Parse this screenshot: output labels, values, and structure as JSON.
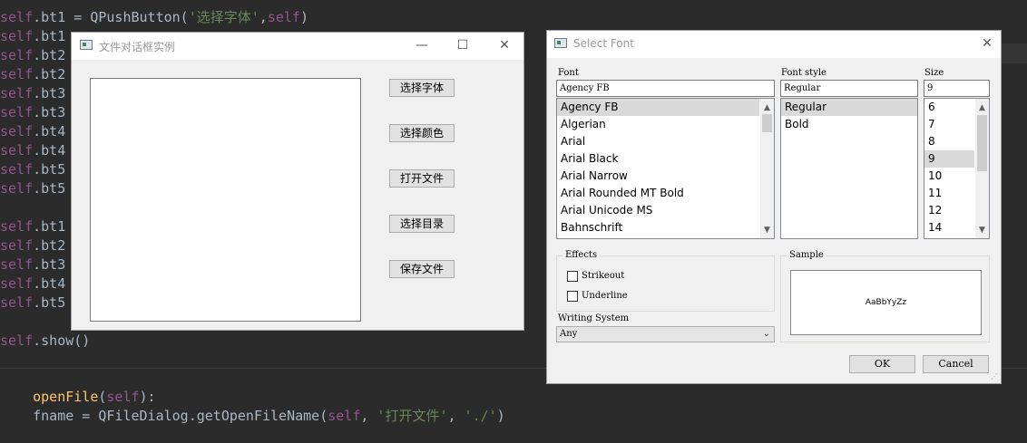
{
  "editor": {
    "lines": [
      {
        "pre": "",
        "self": "self",
        "mid": ".bt1 = QPushButton(",
        "str": "'选择字体'",
        "post": ",",
        "self2": "self",
        "end": ")"
      },
      {
        "pre": "",
        "self": "self",
        "mid": ".bt1",
        "str": "",
        "post": "",
        "self2": "",
        "end": ""
      },
      {
        "pre": "",
        "self": "self",
        "mid": ".bt2",
        "str": "",
        "post": "",
        "self2": "",
        "end": ""
      },
      {
        "pre": "",
        "self": "self",
        "mid": ".bt2",
        "str": "",
        "post": "",
        "self2": "",
        "end": ""
      },
      {
        "pre": "",
        "self": "self",
        "mid": ".bt3",
        "str": "",
        "post": "",
        "self2": "",
        "end": ""
      },
      {
        "pre": "",
        "self": "self",
        "mid": ".bt3",
        "str": "",
        "post": "",
        "self2": "",
        "end": ""
      },
      {
        "pre": "",
        "self": "self",
        "mid": ".bt4",
        "str": "",
        "post": "",
        "self2": "",
        "end": ""
      },
      {
        "pre": "",
        "self": "self",
        "mid": ".bt4",
        "str": "",
        "post": "",
        "self2": "",
        "end": ""
      },
      {
        "pre": "",
        "self": "self",
        "mid": ".bt5",
        "str": "",
        "post": "",
        "self2": "",
        "end": ""
      },
      {
        "pre": "",
        "self": "self",
        "mid": ".bt5",
        "str": "",
        "post": "",
        "self2": "",
        "end": ""
      },
      {
        "pre": "",
        "self": "",
        "mid": "",
        "str": "",
        "post": "",
        "self2": "",
        "end": ""
      },
      {
        "pre": "",
        "self": "self",
        "mid": ".bt1",
        "str": "",
        "post": "",
        "self2": "",
        "end": ""
      },
      {
        "pre": "",
        "self": "self",
        "mid": ".bt2",
        "str": "",
        "post": "",
        "self2": "",
        "end": ""
      },
      {
        "pre": "",
        "self": "self",
        "mid": ".bt3",
        "str": "",
        "post": "",
        "self2": "",
        "end": ""
      },
      {
        "pre": "",
        "self": "self",
        "mid": ".bt4",
        "str": "",
        "post": "",
        "self2": "",
        "end": ""
      },
      {
        "pre": "",
        "self": "self",
        "mid": ".bt5",
        "str": "",
        "post": "",
        "self2": "",
        "end": ""
      },
      {
        "pre": "",
        "self": "",
        "mid": "",
        "str": "",
        "post": "",
        "self2": "",
        "end": ""
      },
      {
        "pre": "",
        "self": "self",
        "mid": ".show()",
        "str": "",
        "post": "",
        "self2": "",
        "end": ""
      },
      {
        "pre": "",
        "self": "",
        "mid": "",
        "str": "",
        "post": "",
        "self2": "",
        "end": ""
      },
      {
        "pre": "",
        "self": "",
        "mid": "",
        "str": "",
        "post": "",
        "self2": "",
        "end": ""
      }
    ],
    "def_fn": "openFile",
    "def_open": "(",
    "def_self": "self",
    "def_close": "):",
    "last_line_pre": "fname = QFileDialog.getOpenFileName(",
    "last_line_self": "self",
    "last_line_mid": ", ",
    "last_line_str1": "'打开文件'",
    "last_line_mid2": ", ",
    "last_line_str2": "'./'",
    "last_line_end": ")"
  },
  "win1": {
    "title": "文件对话框实例",
    "minimize": "—",
    "maximize": "☐",
    "close": "✕",
    "buttons": [
      "选择字体",
      "选择颜色",
      "打开文件",
      "选择目录",
      "保存文件"
    ]
  },
  "font_dialog": {
    "title": "Select Font",
    "close": "✕",
    "font_label": "Font",
    "font_value": "Agency FB",
    "style_label": "Font style",
    "style_value": "Regular",
    "size_label": "Size",
    "size_value": "9",
    "fonts": [
      "Agency FB",
      "Algerian",
      "Arial",
      "Arial Black",
      "Arial Narrow",
      "Arial Rounded MT Bold",
      "Arial Unicode MS",
      "Bahnschrift"
    ],
    "fonts_selected": 0,
    "styles": [
      "Regular",
      "Bold"
    ],
    "styles_selected": 0,
    "sizes": [
      "6",
      "7",
      "8",
      "9",
      "10",
      "11",
      "12",
      "14"
    ],
    "sizes_selected": 3,
    "effects_label": "Effects",
    "strikeout_label": "Strikeout",
    "underline_label": "Underline",
    "strikeout_checked": false,
    "underline_checked": false,
    "writing_system_label": "Writing System",
    "writing_system_value": "Any",
    "sample_label": "Sample",
    "sample_text": "AaBbYyZz",
    "ok_label": "OK",
    "cancel_label": "Cancel"
  },
  "colors": {
    "editor_bg": "#2b2b2b",
    "code_text": "#a9b7c6",
    "self_color": "#94558d",
    "string_color": "#6a8759",
    "function_color": "#ffc66d",
    "dialog_bg": "#f0f0f0",
    "selection": "#d9d9d9"
  }
}
